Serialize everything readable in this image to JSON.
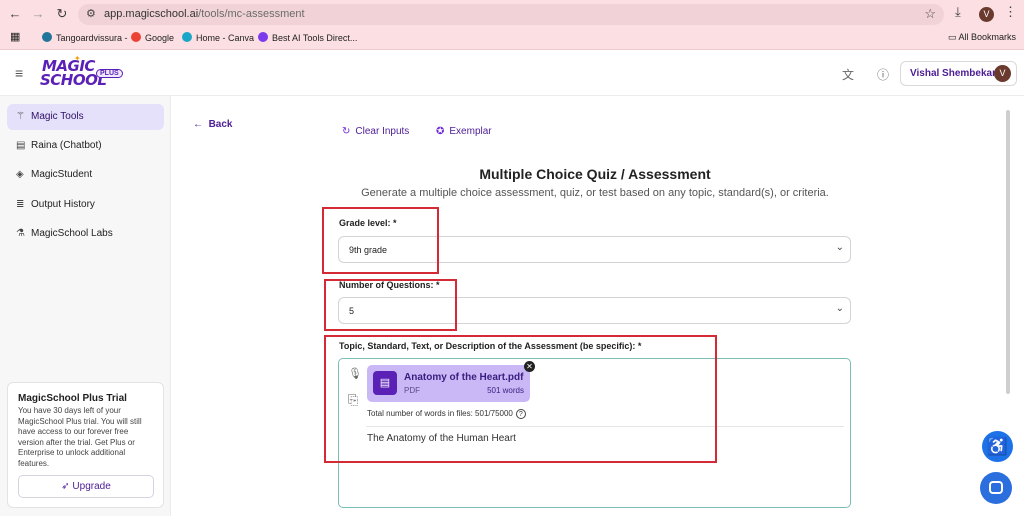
{
  "browser": {
    "back_icon": "arrow-left-icon",
    "forward_icon": "arrow-right-icon",
    "reload_icon": "reload-icon",
    "url_host": "app.magicschool.ai",
    "url_path": "/tools/mc-assessment",
    "profile_initial": "V",
    "bookmarks": [
      "Tangoardvissura -",
      "Google",
      "Home - Canva",
      "Best AI Tools Direct..."
    ],
    "all_bookmarks": "All Bookmarks"
  },
  "header": {
    "logo_line1": "MAGIC",
    "logo_line2": "SCHOOL",
    "logo_badge": "PLUS",
    "user_name": "Vishal Shembekar",
    "user_initial": "V"
  },
  "sidebar": {
    "items": [
      {
        "label": "Magic Tools",
        "icon": "wand-icon",
        "active": true
      },
      {
        "label": "Raina (Chatbot)",
        "icon": "chat-icon",
        "active": false
      },
      {
        "label": "MagicStudent",
        "icon": "graduation-cap-icon",
        "active": false
      },
      {
        "label": "Output History",
        "icon": "list-icon",
        "active": false
      },
      {
        "label": "MagicSchool Labs",
        "icon": "flask-icon",
        "active": false
      }
    ],
    "trial": {
      "title": "MagicSchool Plus Trial",
      "description": "You have 30 days left of your MagicSchool Plus trial. You will still have access to our forever free version after the trial. Get Plus or Enterprise to unlock additional features.",
      "upgrade_label": "Upgrade"
    }
  },
  "main": {
    "back_label": "Back",
    "clear_inputs_label": "Clear Inputs",
    "exemplar_label": "Exemplar",
    "title": "Multiple Choice Quiz / Assessment",
    "subtitle": "Generate a multiple choice assessment, quiz, or test based on any topic, standard(s), or criteria.",
    "grade": {
      "label": "Grade level: *",
      "value": "9th grade"
    },
    "questions": {
      "label": "Number of Questions: *",
      "value": "5"
    },
    "topic": {
      "label": "Topic, Standard, Text, or Description of the Assessment (be specific): *",
      "file_name": "Anatomy of the Heart.pdf",
      "file_type": "PDF",
      "file_words": "501 words",
      "word_count_text": "Total number of words in files: 501/75000",
      "text_value": "The Anatomy of the Human Heart"
    }
  },
  "colors": {
    "brand": "#5b21b6",
    "highlight": "#d42a35",
    "browser_bar": "#fbdfe3"
  }
}
